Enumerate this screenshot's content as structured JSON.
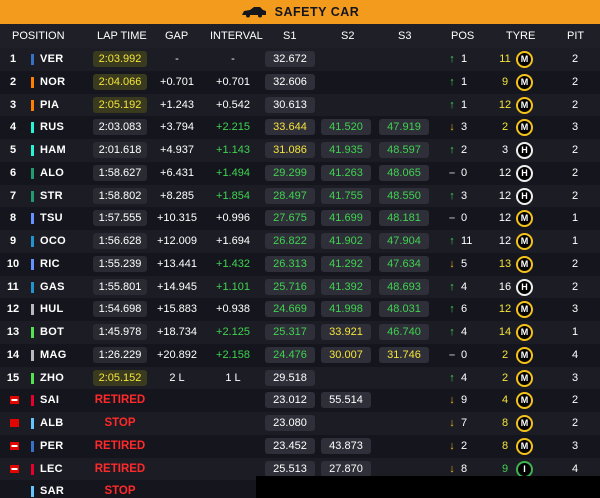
{
  "banner": {
    "text": "SAFETY CAR",
    "icon": "safety-car-icon",
    "color": "#f29b1d"
  },
  "headers": {
    "position": "POSITION",
    "lap_time": "LAP TIME",
    "gap": "GAP",
    "interval": "INTERVAL",
    "s1": "S1",
    "s2": "S2",
    "s3": "S3",
    "pos": "POS",
    "tyre": "TYRE",
    "pit": "PIT"
  },
  "colors": {
    "compound_medium": "#f3c21c",
    "compound_hard": "#eeeeee",
    "compound_intermediate": "#3fb34f",
    "fastest": "#f4e43a",
    "improved": "#3fd34f",
    "retired": "#ff2a2a"
  },
  "rows": [
    {
      "pos": "1",
      "driver": "VER",
      "team_color": "#3671c6",
      "lap": "2:03.992",
      "lap_style": "pb",
      "gap": "-",
      "interval": "-",
      "interval_green": false,
      "s1": "32.672",
      "s1c": "",
      "s2": "",
      "s2c": "",
      "s3": "",
      "s3c": "",
      "dir": "up",
      "poschange": "1",
      "age": "11",
      "age_c": "y",
      "compound": "M",
      "pit": "2"
    },
    {
      "pos": "2",
      "driver": "NOR",
      "team_color": "#ff8000",
      "lap": "2:04.066",
      "lap_style": "pb",
      "gap": "+0.701",
      "interval": "+0.701",
      "interval_green": false,
      "s1": "32.606",
      "s1c": "",
      "s2": "",
      "s2c": "",
      "s3": "",
      "s3c": "",
      "dir": "up",
      "poschange": "1",
      "age": "9",
      "age_c": "y",
      "compound": "M",
      "pit": "2"
    },
    {
      "pos": "3",
      "driver": "PIA",
      "team_color": "#ff8000",
      "lap": "2:05.192",
      "lap_style": "pb",
      "gap": "+1.243",
      "interval": "+0.542",
      "interval_green": false,
      "s1": "30.613",
      "s1c": "",
      "s2": "",
      "s2c": "",
      "s3": "",
      "s3c": "",
      "dir": "up",
      "poschange": "1",
      "age": "12",
      "age_c": "y",
      "compound": "M",
      "pit": "2"
    },
    {
      "pos": "4",
      "driver": "RUS",
      "team_color": "#27f4d2",
      "lap": "2:03.083",
      "lap_style": "plain",
      "gap": "+3.794",
      "interval": "+2.215",
      "interval_green": true,
      "s1": "33.644",
      "s1c": "y",
      "s2": "41.520",
      "s2c": "g",
      "s3": "47.919",
      "s3c": "g",
      "dir": "down",
      "poschange": "3",
      "age": "2",
      "age_c": "y",
      "compound": "M",
      "pit": "3"
    },
    {
      "pos": "5",
      "driver": "HAM",
      "team_color": "#27f4d2",
      "lap": "2:01.618",
      "lap_style": "plain",
      "gap": "+4.937",
      "interval": "+1.143",
      "interval_green": true,
      "s1": "31.086",
      "s1c": "y",
      "s2": "41.935",
      "s2c": "g",
      "s3": "48.597",
      "s3c": "g",
      "dir": "up",
      "poschange": "2",
      "age": "3",
      "age_c": "",
      "compound": "H",
      "pit": "2"
    },
    {
      "pos": "6",
      "driver": "ALO",
      "team_color": "#229971",
      "lap": "1:58.627",
      "lap_style": "plain",
      "gap": "+6.431",
      "interval": "+1.494",
      "interval_green": true,
      "s1": "29.299",
      "s1c": "g",
      "s2": "41.263",
      "s2c": "g",
      "s3": "48.065",
      "s3c": "g",
      "dir": "eq",
      "poschange": "0",
      "age": "12",
      "age_c": "",
      "compound": "H",
      "pit": "2"
    },
    {
      "pos": "7",
      "driver": "STR",
      "team_color": "#229971",
      "lap": "1:58.802",
      "lap_style": "plain",
      "gap": "+8.285",
      "interval": "+1.854",
      "interval_green": true,
      "s1": "28.497",
      "s1c": "g",
      "s2": "41.755",
      "s2c": "g",
      "s3": "48.550",
      "s3c": "g",
      "dir": "up",
      "poschange": "3",
      "age": "12",
      "age_c": "",
      "compound": "H",
      "pit": "2"
    },
    {
      "pos": "8",
      "driver": "TSU",
      "team_color": "#6692ff",
      "lap": "1:57.555",
      "lap_style": "plain",
      "gap": "+10.315",
      "interval": "+0.996",
      "interval_green": false,
      "s1": "27.675",
      "s1c": "g",
      "s2": "41.699",
      "s2c": "g",
      "s3": "48.181",
      "s3c": "g",
      "dir": "eq",
      "poschange": "0",
      "age": "12",
      "age_c": "",
      "compound": "M",
      "pit": "1"
    },
    {
      "pos": "9",
      "driver": "OCO",
      "team_color": "#2293d1",
      "lap": "1:56.628",
      "lap_style": "plain",
      "gap": "+12.009",
      "interval": "+1.694",
      "interval_green": false,
      "s1": "26.822",
      "s1c": "g",
      "s2": "41.902",
      "s2c": "g",
      "s3": "47.904",
      "s3c": "g",
      "dir": "up",
      "poschange": "11",
      "age": "12",
      "age_c": "",
      "compound": "M",
      "pit": "1"
    },
    {
      "pos": "10",
      "driver": "RIC",
      "team_color": "#6692ff",
      "lap": "1:55.239",
      "lap_style": "plain",
      "gap": "+13.441",
      "interval": "+1.432",
      "interval_green": true,
      "s1": "26.313",
      "s1c": "g",
      "s2": "41.292",
      "s2c": "g",
      "s3": "47.634",
      "s3c": "g",
      "dir": "down",
      "poschange": "5",
      "age": "13",
      "age_c": "y",
      "compound": "M",
      "pit": "2"
    },
    {
      "pos": "11",
      "driver": "GAS",
      "team_color": "#2293d1",
      "lap": "1:55.801",
      "lap_style": "plain",
      "gap": "+14.945",
      "interval": "+1.101",
      "interval_green": true,
      "s1": "25.716",
      "s1c": "g",
      "s2": "41.392",
      "s2c": "g",
      "s3": "48.693",
      "s3c": "g",
      "dir": "up",
      "poschange": "4",
      "age": "16",
      "age_c": "",
      "compound": "H",
      "pit": "2"
    },
    {
      "pos": "12",
      "driver": "HUL",
      "team_color": "#b6babd",
      "lap": "1:54.698",
      "lap_style": "plain",
      "gap": "+15.883",
      "interval": "+0.938",
      "interval_green": false,
      "s1": "24.669",
      "s1c": "g",
      "s2": "41.998",
      "s2c": "g",
      "s3": "48.031",
      "s3c": "g",
      "dir": "up",
      "poschange": "6",
      "age": "12",
      "age_c": "y",
      "compound": "M",
      "pit": "3"
    },
    {
      "pos": "13",
      "driver": "BOT",
      "team_color": "#52e252",
      "lap": "1:45.978",
      "lap_style": "plain",
      "gap": "+18.734",
      "interval": "+2.125",
      "interval_green": true,
      "s1": "25.317",
      "s1c": "g",
      "s2": "33.921",
      "s2c": "y",
      "s3": "46.740",
      "s3c": "g",
      "dir": "up",
      "poschange": "4",
      "age": "14",
      "age_c": "y",
      "compound": "M",
      "pit": "1"
    },
    {
      "pos": "14",
      "driver": "MAG",
      "team_color": "#b6babd",
      "lap": "1:26.229",
      "lap_style": "plain",
      "gap": "+20.892",
      "interval": "+2.158",
      "interval_green": true,
      "s1": "24.476",
      "s1c": "g",
      "s2": "30.007",
      "s2c": "y",
      "s3": "31.746",
      "s3c": "y",
      "dir": "eq",
      "poschange": "0",
      "age": "2",
      "age_c": "y",
      "compound": "M",
      "pit": "4"
    },
    {
      "pos": "15",
      "driver": "ZHO",
      "team_color": "#52e252",
      "lap": "2:05.152",
      "lap_style": "pb",
      "gap": "2 L",
      "interval": "1 L",
      "interval_green": false,
      "s1": "29.518",
      "s1c": "",
      "s2": "",
      "s2c": "",
      "s3": "",
      "s3c": "",
      "dir": "up",
      "poschange": "4",
      "age": "2",
      "age_c": "y",
      "compound": "M",
      "pit": "3"
    },
    {
      "pos": "",
      "flag": "retired",
      "driver": "SAI",
      "team_color": "#e8002d",
      "lap": "RETIRED",
      "lap_style": "status",
      "gap": "",
      "interval": "",
      "interval_green": false,
      "s1": "23.012",
      "s1c": "",
      "s2": "55.514",
      "s2c": "",
      "s3": "",
      "s3c": "",
      "dir": "down",
      "poschange": "9",
      "age": "4",
      "age_c": "y",
      "compound": "M",
      "pit": "2"
    },
    {
      "pos": "",
      "flag": "stop",
      "driver": "ALB",
      "team_color": "#64c4ff",
      "lap": "STOP",
      "lap_style": "status",
      "gap": "",
      "interval": "",
      "interval_green": false,
      "s1": "23.080",
      "s1c": "",
      "s2": "",
      "s2c": "",
      "s3": "",
      "s3c": "",
      "dir": "down",
      "poschange": "7",
      "age": "8",
      "age_c": "y",
      "compound": "M",
      "pit": "2"
    },
    {
      "pos": "",
      "flag": "retired",
      "driver": "PER",
      "team_color": "#3671c6",
      "lap": "RETIRED",
      "lap_style": "status",
      "gap": "",
      "interval": "",
      "interval_green": false,
      "s1": "23.452",
      "s1c": "",
      "s2": "43.873",
      "s2c": "",
      "s3": "",
      "s3c": "",
      "dir": "down",
      "poschange": "2",
      "age": "8",
      "age_c": "y",
      "compound": "M",
      "pit": "3"
    },
    {
      "pos": "",
      "flag": "retired",
      "driver": "LEC",
      "team_color": "#e8002d",
      "lap": "RETIRED",
      "lap_style": "status",
      "gap": "",
      "interval": "",
      "interval_green": false,
      "s1": "25.513",
      "s1c": "",
      "s2": "27.870",
      "s2c": "",
      "s3": "",
      "s3c": "",
      "dir": "down",
      "poschange": "8",
      "age": "9",
      "age_c": "g",
      "compound": "I",
      "pit": "4"
    },
    {
      "pos": "",
      "flag": "",
      "driver": "SAR",
      "team_color": "#64c4ff",
      "lap": "STOP",
      "lap_style": "status",
      "gap": "",
      "interval": "",
      "interval_green": false,
      "s1": "",
      "s1c": "",
      "s2": "",
      "s2c": "",
      "s3": "",
      "s3c": "",
      "dir": "",
      "poschange": "",
      "age": "",
      "age_c": "",
      "compound": "",
      "pit": ""
    }
  ]
}
